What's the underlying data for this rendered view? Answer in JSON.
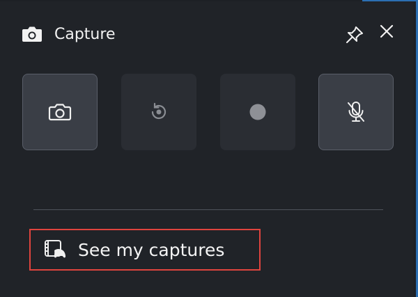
{
  "header": {
    "title": "Capture",
    "icon": "camera-icon"
  },
  "window_controls": {
    "pin_icon": "pin-icon",
    "close_icon": "close-icon"
  },
  "capture_buttons": [
    {
      "name": "screenshot",
      "icon": "camera-icon",
      "state": "enabled"
    },
    {
      "name": "record-last-30-seconds",
      "icon": "rewind-record-icon",
      "state": "disabled"
    },
    {
      "name": "start-recording",
      "icon": "record-dot-icon",
      "state": "disabled"
    },
    {
      "name": "microphone",
      "icon": "mic-off-icon",
      "state": "enabled"
    }
  ],
  "footer": {
    "see_captures_label": "See my captures",
    "see_captures_icon": "gallery-icon"
  },
  "colors": {
    "background": "#202328",
    "highlight_border": "#e0443e",
    "accent_edge": "#2b6fb3"
  }
}
